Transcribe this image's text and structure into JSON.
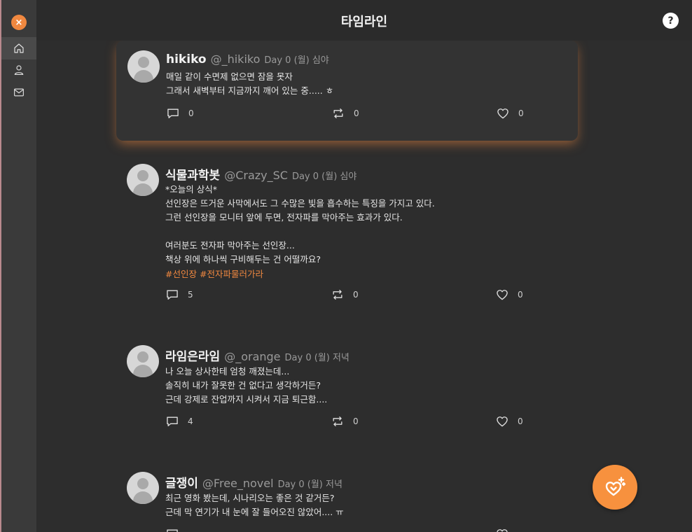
{
  "window": {
    "close_label": "×"
  },
  "sidebar": {
    "items": [
      {
        "icon": "home-icon",
        "label": "home"
      },
      {
        "icon": "profile-icon",
        "label": "profile"
      },
      {
        "icon": "mail-icon",
        "label": "messages"
      }
    ]
  },
  "header": {
    "title": "타임라인",
    "help_label": "?"
  },
  "posts": [
    {
      "name": "hikiko",
      "handle": "@_hikiko",
      "when": "Day 0 (월) 심야",
      "lines": "매일 같이 수면제 없으면 잠을 못자\n그래서 새벽부터 지금까지 깨어 있는 중..... ㅎ",
      "tags": [],
      "replies": "0",
      "retweets": "0",
      "likes": "0"
    },
    {
      "name": "식물과학봇",
      "handle": "@Crazy_SC",
      "when": "Day 0 (월) 심야",
      "lines": "*오늘의 상식*\n선인장은 뜨거운 사막에서도 그 수많은 빛을 흡수하는 특징을 가지고 있다.\n그런 선인장을 모니터 앞에 두면, 전자파를 막아주는 효과가 있다.\n\n여러분도 전자파 막아주는 선인장...\n책상 위에 하나씩 구비해두는 건 어떨까요?",
      "tags": [
        "#선인장",
        "#전자파물러가라"
      ],
      "replies": "5",
      "retweets": "0",
      "likes": "0"
    },
    {
      "name": "라임은라임",
      "handle": "@_orange",
      "when": "Day 0 (월) 저녁",
      "lines": "나 오늘 상사한테 엄청 깨졌는데...\n솔직히 내가 잘못한 건 없다고 생각하거든?\n근데 강제로 잔업까지 시켜서 지금 퇴근함....",
      "tags": [],
      "replies": "4",
      "retweets": "0",
      "likes": "0"
    },
    {
      "name": "글쟁이",
      "handle": "@Free_novel",
      "when": "Day 0 (월) 저녁",
      "lines": "최근 영화 봤는데, 시나리오는 좋은 것 같거든?\n근데 막 연기가 내 눈에 잘 들어오진 않았어.... ㅠ",
      "tags": [],
      "replies": "",
      "retweets": "",
      "likes": ""
    }
  ],
  "fab": {
    "icon": "heart-sparkle-icon"
  },
  "colors": {
    "accent": "#f08840",
    "background": "#2d2d2d",
    "sidebar": "#3a3a3a"
  }
}
